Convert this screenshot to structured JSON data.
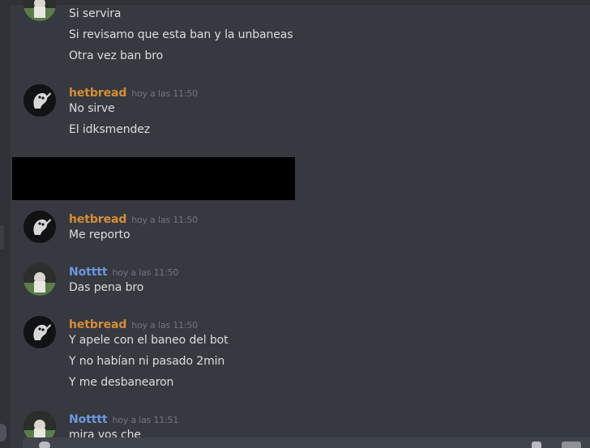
{
  "colors": {
    "background": "#36393f",
    "sidebar": "#2f3136",
    "text": "#dcddde",
    "timestamp": "#72767d",
    "username_orange": "#d58e3a",
    "username_blue": "#6d97e0",
    "redaction": "#000000"
  },
  "messages": [
    {
      "avatar": "photo-avatar",
      "lines": [
        "Si servira",
        "Si revisamo que esta ban y la unbaneas",
        "Otra vez ban bro"
      ]
    },
    {
      "author": "hetbread",
      "timestamp": "hoy a las 11:50",
      "avatar": "ghost-avatar",
      "lines": [
        "No sirve",
        "El idksmendez"
      ]
    },
    {
      "author": "hetbread",
      "timestamp": "hoy a las 11:50",
      "avatar": "ghost-avatar",
      "lines": [
        "Me reporto"
      ]
    },
    {
      "author": "Notttt",
      "timestamp": "hoy a las 11:50",
      "avatar": "photo-avatar",
      "lines": [
        "Das pena bro"
      ]
    },
    {
      "author": "hetbread",
      "timestamp": "hoy a las 11:50",
      "avatar": "ghost-avatar",
      "lines": [
        "Y apele con el baneo del bot",
        "Y no habían ni pasado 2min",
        "Y me desbanearon"
      ]
    },
    {
      "author": "Notttt",
      "timestamp": "hoy a las 11:51",
      "avatar": "photo-avatar",
      "lines": [
        "mira vos che"
      ]
    }
  ]
}
